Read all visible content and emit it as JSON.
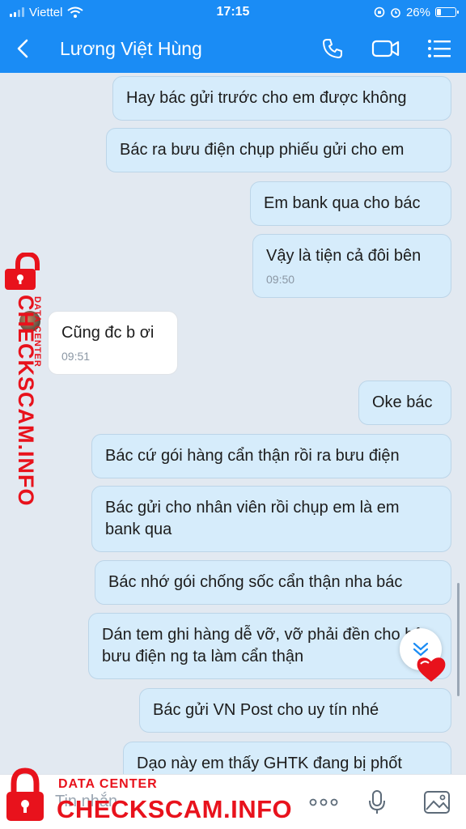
{
  "status_bar": {
    "carrier": "Viettel",
    "time": "17:15",
    "battery": "26%",
    "battery_level": 0.26
  },
  "header": {
    "contact_name": "Lương Việt Hùng",
    "icons": [
      "back-icon",
      "phone-icon",
      "video-call-icon",
      "menu-icon"
    ]
  },
  "messages": [
    {
      "direction": "out",
      "text": "Hay bác gửi trước cho em được không",
      "time": ""
    },
    {
      "direction": "out",
      "text": "Bác ra bưu điện chụp phiếu gửi cho em",
      "time": ""
    },
    {
      "direction": "out",
      "text": "Em bank qua cho bác",
      "time": ""
    },
    {
      "direction": "out",
      "text": "Vậy là tiện cả đôi bên",
      "time": "09:50"
    },
    {
      "direction": "in",
      "text": "Cũng đc b ơi",
      "time": "09:51"
    },
    {
      "direction": "out",
      "text": "Oke bác",
      "time": ""
    },
    {
      "direction": "out",
      "text": "Bác cứ gói hàng cẩn thận rồi ra bưu điện",
      "time": ""
    },
    {
      "direction": "out",
      "text": "Bác gửi cho nhân viên rồi chụp em là em bank qua",
      "time": ""
    },
    {
      "direction": "out",
      "text": "Bác nhớ gói chống sốc cẩn thận nha bác",
      "time": ""
    },
    {
      "direction": "out",
      "text": "Dán tem ghi hàng dễ vỡ, vỡ phải đền cho bên bưu điện ng ta làm cẩn thận",
      "time": ""
    },
    {
      "direction": "out",
      "text": "Bác gửi VN Post cho uy tín nhé",
      "time": ""
    },
    {
      "direction": "out",
      "text": "Dạo này em thấy GHTK đang bị phốt",
      "time": ""
    }
  ],
  "input": {
    "placeholder": "Tin nhắn"
  },
  "watermark": {
    "small": "DATA CENTER",
    "big": "CHECKSCAM.INFO"
  },
  "colors": {
    "accent": "#1a8cf5",
    "bubble_out": "#d6ecfb",
    "bubble_in": "#ffffff",
    "chat_bg": "#e2e9f1",
    "watermark": "#e8121c"
  }
}
